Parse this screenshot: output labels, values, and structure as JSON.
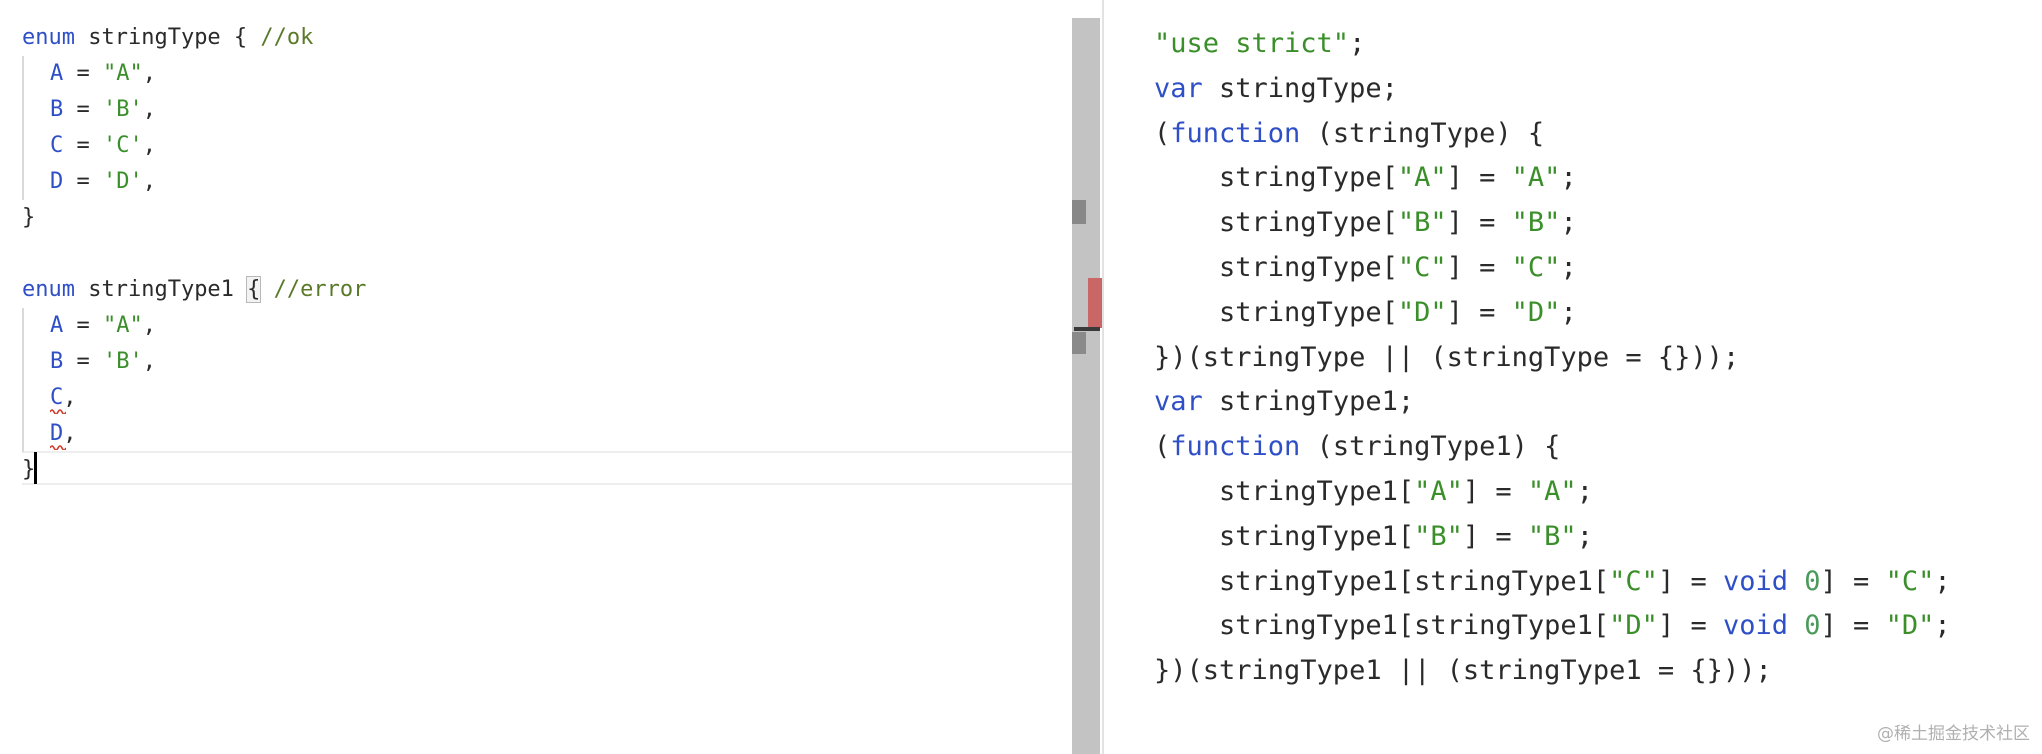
{
  "left_editor": {
    "lines": [
      {
        "kw": "enum",
        "name": " stringType {",
        "comment": " //ok"
      },
      {
        "member": "A",
        "op": " = ",
        "val": "\"A\"",
        "tail": ","
      },
      {
        "member": "B",
        "op": " = ",
        "val": "'B'",
        "tail": ","
      },
      {
        "member": "C",
        "op": " = ",
        "val": "'C'",
        "tail": ","
      },
      {
        "member": "D",
        "op": " = ",
        "val": "'D'",
        "tail": ","
      },
      {
        "text": "}"
      },
      {
        "kw": "enum",
        "name": " stringType1 ",
        "brace": "{",
        "comment": " //error"
      },
      {
        "member": "A",
        "op": " = ",
        "val": "\"A\"",
        "tail": ","
      },
      {
        "member": "B",
        "op": " = ",
        "val": "'B'",
        "tail": ","
      },
      {
        "member": "C",
        "tail": ","
      },
      {
        "member": "D",
        "tail": ","
      },
      {
        "text": "}"
      }
    ]
  },
  "right_pane": {
    "lines": [
      [
        {
          "c": "str",
          "t": "\"use strict\""
        },
        {
          "c": "id",
          "t": ";"
        }
      ],
      [
        {
          "c": "kw",
          "t": "var"
        },
        {
          "c": "id",
          "t": " stringType;"
        }
      ],
      [
        {
          "c": "id",
          "t": "("
        },
        {
          "c": "kw",
          "t": "function"
        },
        {
          "c": "id",
          "t": " (stringType) {"
        }
      ],
      [
        {
          "c": "id",
          "t": "    stringType["
        },
        {
          "c": "str",
          "t": "\"A\""
        },
        {
          "c": "id",
          "t": "] = "
        },
        {
          "c": "str",
          "t": "\"A\""
        },
        {
          "c": "id",
          "t": ";"
        }
      ],
      [
        {
          "c": "id",
          "t": "    stringType["
        },
        {
          "c": "str",
          "t": "\"B\""
        },
        {
          "c": "id",
          "t": "] = "
        },
        {
          "c": "str",
          "t": "\"B\""
        },
        {
          "c": "id",
          "t": ";"
        }
      ],
      [
        {
          "c": "id",
          "t": "    stringType["
        },
        {
          "c": "str",
          "t": "\"C\""
        },
        {
          "c": "id",
          "t": "] = "
        },
        {
          "c": "str",
          "t": "\"C\""
        },
        {
          "c": "id",
          "t": ";"
        }
      ],
      [
        {
          "c": "id",
          "t": "    stringType["
        },
        {
          "c": "str",
          "t": "\"D\""
        },
        {
          "c": "id",
          "t": "] = "
        },
        {
          "c": "str",
          "t": "\"D\""
        },
        {
          "c": "id",
          "t": ";"
        }
      ],
      [
        {
          "c": "id",
          "t": "})(stringType || (stringType = {}));"
        }
      ],
      [
        {
          "c": "kw",
          "t": "var"
        },
        {
          "c": "id",
          "t": " stringType1;"
        }
      ],
      [
        {
          "c": "id",
          "t": "("
        },
        {
          "c": "kw",
          "t": "function"
        },
        {
          "c": "id",
          "t": " (stringType1) {"
        }
      ],
      [
        {
          "c": "id",
          "t": "    stringType1["
        },
        {
          "c": "str",
          "t": "\"A\""
        },
        {
          "c": "id",
          "t": "] = "
        },
        {
          "c": "str",
          "t": "\"A\""
        },
        {
          "c": "id",
          "t": ";"
        }
      ],
      [
        {
          "c": "id",
          "t": "    stringType1["
        },
        {
          "c": "str",
          "t": "\"B\""
        },
        {
          "c": "id",
          "t": "] = "
        },
        {
          "c": "str",
          "t": "\"B\""
        },
        {
          "c": "id",
          "t": ";"
        }
      ],
      [
        {
          "c": "id",
          "t": "    stringType1[stringType1["
        },
        {
          "c": "str",
          "t": "\"C\""
        },
        {
          "c": "id",
          "t": "] = "
        },
        {
          "c": "kw",
          "t": "void"
        },
        {
          "c": "id",
          "t": " "
        },
        {
          "c": "num",
          "t": "0"
        },
        {
          "c": "id",
          "t": "] = "
        },
        {
          "c": "str",
          "t": "\"C\""
        },
        {
          "c": "id",
          "t": ";"
        }
      ],
      [
        {
          "c": "id",
          "t": "    stringType1[stringType1["
        },
        {
          "c": "str",
          "t": "\"D\""
        },
        {
          "c": "id",
          "t": "] = "
        },
        {
          "c": "kw",
          "t": "void"
        },
        {
          "c": "id",
          "t": " "
        },
        {
          "c": "num",
          "t": "0"
        },
        {
          "c": "id",
          "t": "] = "
        },
        {
          "c": "str",
          "t": "\"D\""
        },
        {
          "c": "id",
          "t": ";"
        }
      ],
      [
        {
          "c": "id",
          "t": "})(stringType1 || (stringType1 = {}));"
        }
      ]
    ]
  },
  "watermark": "@稀土掘金技术社区"
}
